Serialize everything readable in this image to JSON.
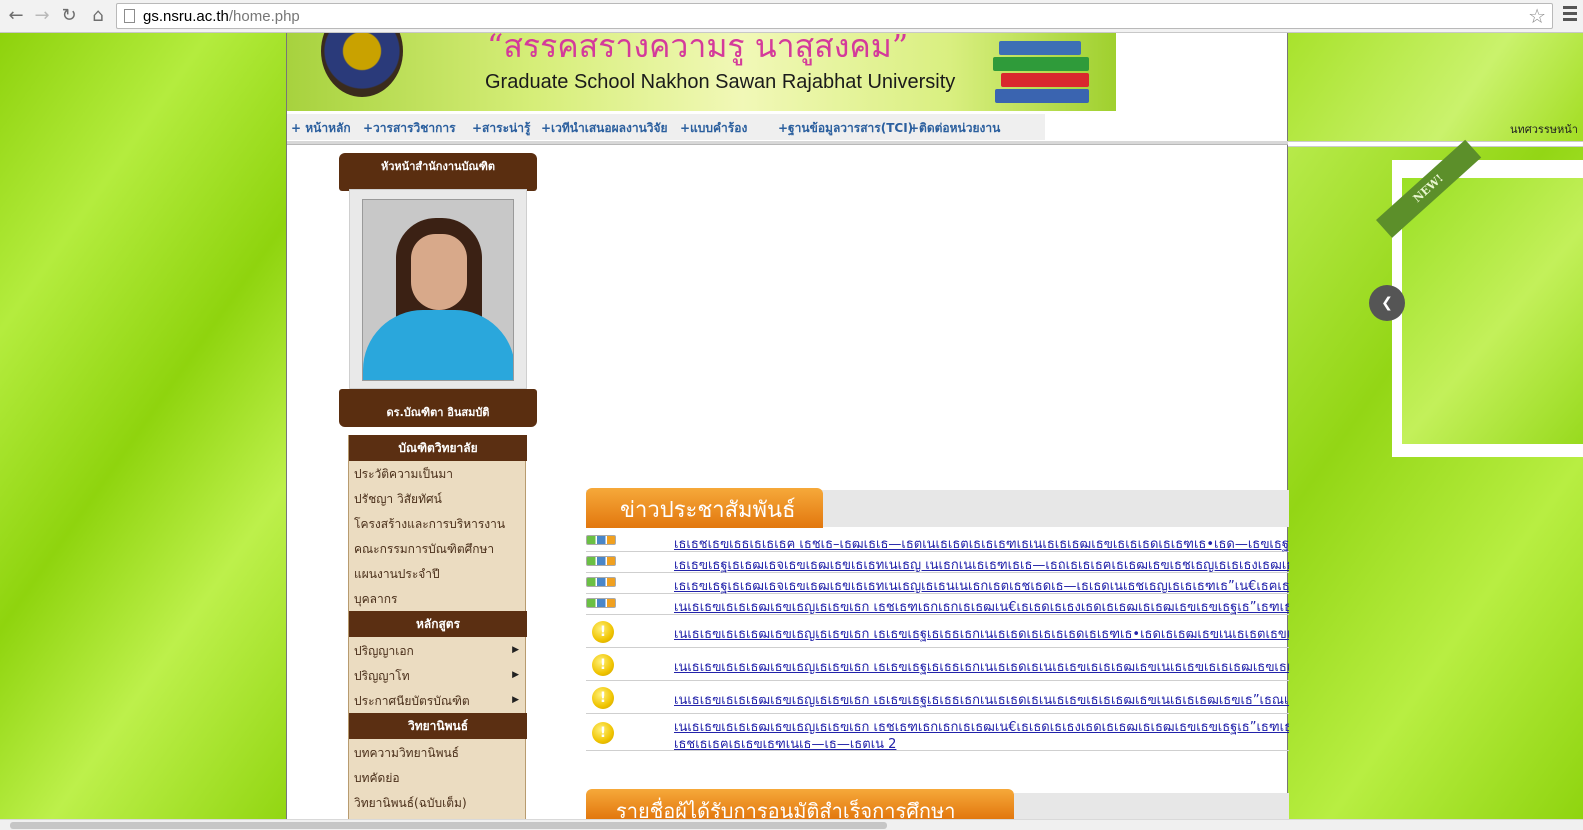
{
  "browser": {
    "url_host": "gs.nsru.ac.th",
    "url_path": "/home.php"
  },
  "banner": {
    "slogan": "“สรรคสรางความรู  นาสูสงคม”",
    "school_name": "Graduate School Nakhon Sawan Rajabhat University"
  },
  "menu": [
    "+ หน้าหลัก",
    "+วารสารวิชาการ",
    "+สาระน่ารู้",
    "+เวทีนำเสนอผลงานวิจัย",
    "+แบบคำร้อง",
    "+ฐานข้อมูลวารสาร(TCI)",
    "+ติดต่อหน่วยงาน"
  ],
  "director": {
    "title": "หัวหน้าสำนักงานบัณฑิต",
    "name": "ดร.บัณฑิตา อินสมบัติ"
  },
  "sidebar": {
    "sections": [
      {
        "heading": "บัณฑิตวิทยาลัย",
        "items": [
          "ประวัติความเป็นมา",
          "ปรัชญา วิสัยทัศน์",
          "โครงสร้างและการบริหารงาน",
          "คณะกรรมการบัณฑิตศึกษา",
          "แผนงานประจำปี",
          "บุคลากร"
        ]
      },
      {
        "heading": "หลักสูตร",
        "items": [
          "ปริญญาเอก",
          "ปริญญาโท",
          "ประกาศนียบัตรบัณฑิต"
        ]
      },
      {
        "heading": "วิทยานิพนธ์",
        "items": [
          "บทความวิทยานิพนธ์",
          "บทคัดย่อ",
          "วิทยานิพนธ์(ฉบับเต็ม)"
        ]
      }
    ]
  },
  "news": {
    "heading": "ข่าวประชาสัมพันธ์",
    "items": [
      "เธเธชเธฃเธธเธเธเธฅ เธชเธ–เธฒเธเธ—เธตเนเธเธตเธเธเธฑเธเนเธเธเธฒเธฃเธเธเธดเธเธฑเธ•เธด—เธฃเธฐเธเธฑเธเนเธเธดเนเธชเธฉเธเธดเธเธเธฃเธฐเธเธณเธเธตเธเธฒเธฃเธจเธถเธเธฉเธฒ",
      "เธเธฃเธฐเธเธฒเธจเธฃเธฒเธขเธเธทเนเธญ เนเธกเนเธเธฑเธเธ—เธถเธเธเธฅเธเธฒเธฃเธชเธญเธเธเธงเธฒเธกเธฃเธนเนเธ—เธฒเธเธ เธฒเธฉเธฒเธญเธฑเธเธเธคเธฉ—เธชเธณเธซเธฃเธฑเธเธเธฑเธเธจเธถเธเธฉเธฒเธฃเธฐเธ”เธฑเธ",
      "เธเธฃเธฐเธเธฒเธจเธฃเธฒเธขเธเธทเนเธญเธเธนเนเธกเธตเธชเธดเธ—เธเธดเนเธชเธญเธเธเธฑเธ”เน€เธฅเธทเธญเธ——เธเธฑเธเธจเธถเธเธฉเธฒเธฃเธฐเธ”เธฑเธเธเธฃเธดเธเธเธฒเนเธ— เธเธตเธเธฒเธฃเธจเธถเธเธฉเธฒ เธ.เธจ. 2557",
      "เนเธเธฃเธเธเธฒเธฃเธญเธเธฃเธก เธชเธฑเธกเธกเธเธฒเน€เธเธดเธเธงเธดเธเธฒเธเธฒเธฃเธฃเธฐเธ”เธฑเธเธเธฒเธ•เธดเนเธฅเธฐเธเธฒเธเธฒเธเธฒเธ•เธด—เธเธฃเธฑเนเธเธ—เธตเน",
      "เนเธเธฃเธเธเธฒเธฃเธญเธเธฃเธก เธเธฃเธฐเธเธธเธกเนเธเธดเธเธเธเธดเธเธฑเธ•เธดเธเธฒเธฃเนเธเธตเธขเธเธเธ—เธเธงเธฒเธกเธงเธดเธเธฒเธเธฒเธฃเน€เธเธทเนเธญเธ•เธตเธเธดเธกเธเนเนเธเธงเธฒเธฃเธชเธฒเธฃ",
      "เนเธเธฃเธเธเธฒเธฃเธญเธเธฃเธก เธเธฃเธฐเธเธธเธกเนเธเธดเธเนเธเธฃเธเธเธฒเธฃเนเธเธฃเธเธเธฒเธฃเธเธฑเธ’เธเธฒเธจเธฑเธเธขเธ เธฒเธเธญเธฒเธเธฒเธฃเธขเนเธ—เธตเนเธเธฃเธถเธเธฉเธฒ",
      "เนเธเธฃเธเธเธฒเธฃเธญเธเธฃเธก เธเธฃเธฐเธเธธเธกเนเธเธดเธเนเธเธฃเธเธเธฒเธฃเนเธเธเธฒเธฃเธ”เธณเน€เธเธดเธเธเธฒเธเธเธฃเธฐเธเธฑเธเธเธธเธ“เธ เธฒเธเธเธฒเธฃเธจเธถเธเธฉเธฒ",
      "เนเธเธฃเธเธเธฒเธฃเธญเธเธฃเธก เธชเธฑเธกเธกเธเธฒเน€เธเธดเธเธงเธดเธเธฒเธเธฒเธฃเธฃเธฐเธ”เธฑเธเธเธฒเธ•เธดเนเธฅเธฐเธเธฒเธเธฒเธเธฒเธ•เธดเธเธฒเธเธงเธดเธเธฑเธขเนเธฅเธฐเธเธงเธฒเธกเธเธดเธเธชเธฃเนเธฒเธเธชเธฃเธฃเธเน"
    ],
    "last_item_line2": "เธชเธเธฅเธเธฃเธฑเนเธ—เธ—เธตเน 2"
  },
  "news2": {
    "heading": "รายชื่อผู้ได้รับการอนุมัติสำเร็จการศึกษา"
  },
  "right": {
    "label": "นทศวรรษหน้า",
    "ribbon": "NEW!",
    "prev_icon": "chevron-left-icon"
  },
  "colors": {
    "lime_background": "#9fdc1e",
    "sidebar_brown": "#5a2e10",
    "news_orange": "#e2770e",
    "link_blue": "#2222aa"
  }
}
